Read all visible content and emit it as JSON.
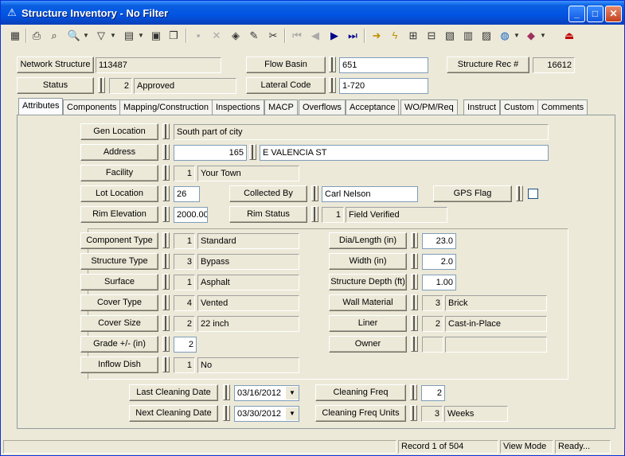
{
  "window": {
    "title": "Structure Inventory - No Filter"
  },
  "header": {
    "network_structure": {
      "label": "Network Structure",
      "value": "113487"
    },
    "flow_basin": {
      "label": "Flow Basin",
      "value": "651"
    },
    "structure_rec": {
      "label": "Structure Rec #",
      "value": "16612"
    },
    "status": {
      "label": "Status",
      "code": "2",
      "value": "Approved"
    },
    "lateral_code": {
      "label": "Lateral Code",
      "value": "1-720"
    }
  },
  "tabs": [
    "Attributes",
    "Components",
    "Mapping/Construction",
    "Inspections",
    "MACP",
    "Overflows",
    "Acceptance",
    "WO/PM/Req",
    "Instruct",
    "Custom",
    "Comments"
  ],
  "attributes": {
    "gen_location": {
      "label": "Gen Location",
      "value": "South part of city"
    },
    "address": {
      "label": "Address",
      "number": "165",
      "street": "E VALENCIA ST"
    },
    "facility": {
      "label": "Facility",
      "code": "1",
      "value": "Your Town"
    },
    "lot_location": {
      "label": "Lot Location",
      "value": "26"
    },
    "collected_by": {
      "label": "Collected By",
      "value": "Carl Nelson"
    },
    "gps_flag": {
      "label": "GPS Flag"
    },
    "rim_elevation": {
      "label": "Rim Elevation",
      "value": "2000.00"
    },
    "rim_status": {
      "label": "Rim Status",
      "code": "1",
      "value": "Field Verified"
    },
    "component_type": {
      "label": "Component Type",
      "code": "1",
      "value": "Standard"
    },
    "structure_type": {
      "label": "Structure Type",
      "code": "3",
      "value": "Bypass"
    },
    "surface": {
      "label": "Surface",
      "code": "1",
      "value": "Asphalt"
    },
    "cover_type": {
      "label": "Cover Type",
      "code": "4",
      "value": "Vented"
    },
    "cover_size": {
      "label": "Cover Size",
      "code": "2",
      "value": "22 inch"
    },
    "grade": {
      "label": "Grade +/- (in)",
      "value": "2"
    },
    "inflow_dish": {
      "label": "Inflow Dish",
      "code": "1",
      "value": "No"
    },
    "dia_length": {
      "label": "Dia/Length (in)",
      "value": "23.0"
    },
    "width": {
      "label": "Width (in)",
      "value": "2.0"
    },
    "structure_depth": {
      "label": "Structure Depth (ft)",
      "value": "1.00"
    },
    "wall_material": {
      "label": "Wall Material",
      "code": "3",
      "value": "Brick"
    },
    "liner": {
      "label": "Liner",
      "code": "2",
      "value": "Cast-in-Place"
    },
    "owner": {
      "label": "Owner",
      "code": "",
      "value": ""
    },
    "last_cleaning_date": {
      "label": "Last Cleaning Date",
      "value": "03/16/2012"
    },
    "next_cleaning_date": {
      "label": "Next Cleaning Date",
      "value": "03/30/2012"
    },
    "cleaning_freq": {
      "label": "Cleaning Freq",
      "value": "2"
    },
    "cleaning_freq_units": {
      "label": "Cleaning Freq Units",
      "code": "3",
      "value": "Weeks"
    }
  },
  "statusbar": {
    "record": "Record 1 of 504",
    "mode": "View Mode",
    "state": "Ready..."
  }
}
